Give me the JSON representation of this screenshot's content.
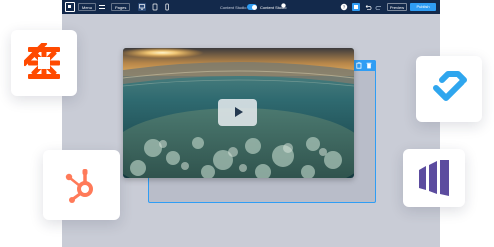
{
  "toolbar": {
    "menu_label": "Menu",
    "pages_label": "Pages",
    "mode_label_left": "Content Studio",
    "mode_label_right": "Content Studio",
    "preview_label": "Preview",
    "publish_label": "Publish"
  },
  "icons": {
    "logo": "site-logo-icon",
    "devices": [
      "desktop-icon",
      "tablet-icon",
      "mobile-icon"
    ],
    "actions": [
      "help-icon",
      "undo-icon",
      "redo-icon",
      "settings-icon"
    ],
    "module": [
      "copy-icon",
      "delete-icon"
    ]
  },
  "integrations": [
    "zapier-logo",
    "hubspot-logo",
    "linked-logo",
    "marketo-logo"
  ],
  "colors": {
    "toolbar": "#13294b",
    "accent": "#2f9df4",
    "zapier": "#ff4a00",
    "hubspot": "#ff7a59",
    "linked": "#2fa6ee",
    "marketo": "#5c4c9f"
  }
}
